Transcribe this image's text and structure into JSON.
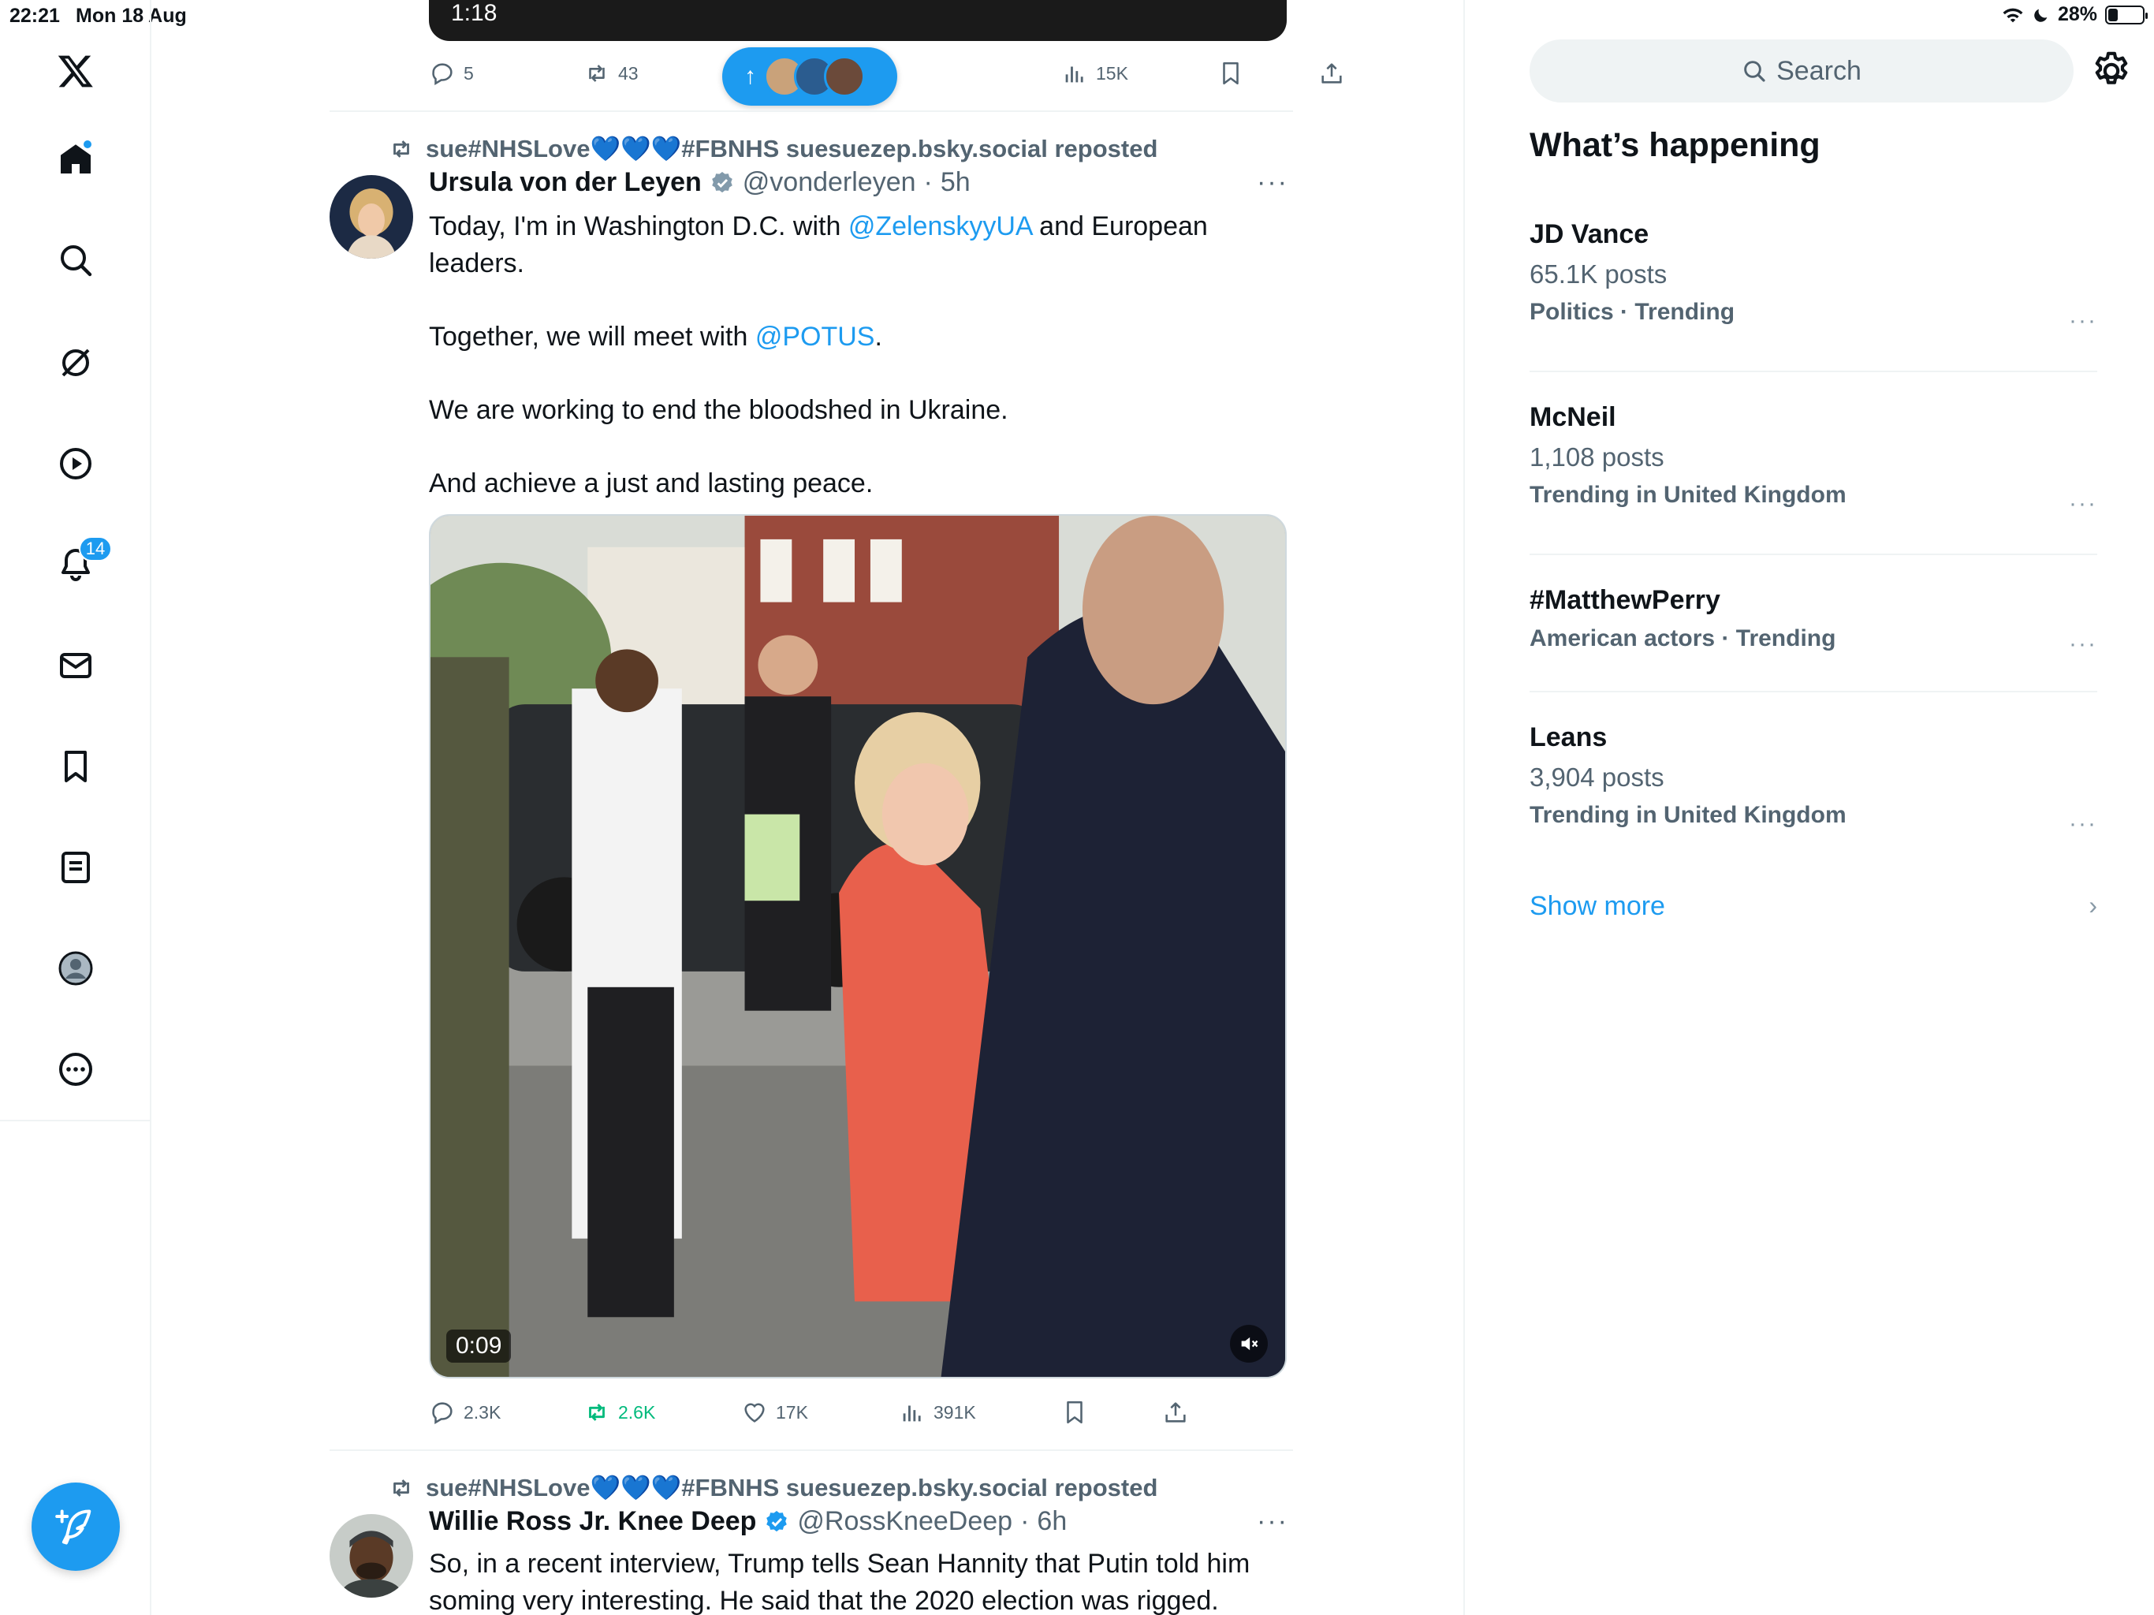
{
  "status_bar": {
    "time": "22:21",
    "date": "Mon 18 Aug",
    "battery": "28%",
    "battery_level": 0.28
  },
  "nav": {
    "notifications_badge": "14",
    "items": [
      "X",
      "Home",
      "Explore",
      "Grok",
      "Video",
      "Notifications",
      "Messages",
      "Bookmarks",
      "Lists",
      "Profile",
      "More"
    ]
  },
  "top_media": {
    "time": "1:18"
  },
  "top_actions": {
    "replies": "5",
    "reposts": "43",
    "views": "15K"
  },
  "new_posts_pill": {
    "arrow": "↑"
  },
  "tweet1": {
    "repost_by": "sue#NHSLove",
    "repost_hearts": "💙💙💙",
    "repost_suffix": "#FBNHS suesuezep.bsky.social reposted",
    "name": "Ursula von der Leyen",
    "handle": "@vonderleyen",
    "sep": "·",
    "time": "5h",
    "more": "···",
    "text_p1_a": "Today, I'm in Washington D.C. with ",
    "text_p1_mention": "@ZelenskyyUA",
    "text_p1_b": " and European leaders.",
    "text_p2_a": "Together, we will meet with ",
    "text_p2_mention": "@POTUS",
    "text_p2_b": ".",
    "text_p3": "We are working to end the bloodshed in Ukraine.",
    "text_p4": "And achieve a just and lasting peace.",
    "video_time": "0:09",
    "replies": "2.3K",
    "reposts": "2.6K",
    "likes": "17K",
    "views": "391K"
  },
  "tweet2": {
    "repost_by": "sue#NHSLove",
    "repost_hearts": "💙💙💙",
    "repost_suffix": "#FBNHS suesuezep.bsky.social reposted",
    "name": "Willie Ross Jr. Knee Deep",
    "handle": "@RossKneeDeep",
    "sep": "·",
    "time": "6h",
    "more": "···",
    "text": "So, in a recent interview, Trump tells Sean Hannity that Putin told him soming very interesting.  He said that the 2020 election was rigged."
  },
  "right": {
    "search_placeholder": "Search",
    "title": "What’s happening",
    "trends": [
      {
        "name": "JD Vance",
        "posts": "65.1K posts",
        "meta": "Politics · Trending",
        "more": "···"
      },
      {
        "name": "McNeil",
        "posts": "1,108 posts",
        "meta": "Trending in United Kingdom",
        "more": "···"
      },
      {
        "name": "#MatthewPerry",
        "posts": "",
        "meta": "American actors · Trending",
        "more": "···"
      },
      {
        "name": "Leans",
        "posts": "3,904 posts",
        "meta": "Trending in United Kingdom",
        "more": "···"
      }
    ],
    "show_more": "Show more",
    "show_more_chevron": "›"
  },
  "colors": {
    "accent": "#1d9bf0",
    "repost_green": "#00ba7c",
    "secondary_text": "#536471"
  }
}
